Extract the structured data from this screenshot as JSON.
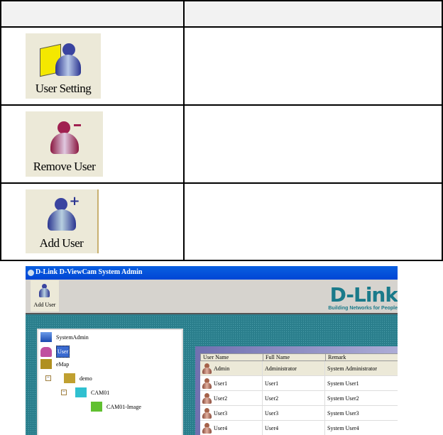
{
  "table": {
    "rows": [
      {
        "icon": "user-setting-icon",
        "label": "User Setting",
        "description": ""
      },
      {
        "icon": "remove-user-icon",
        "label": "Remove User",
        "description": ""
      },
      {
        "icon": "add-user-icon",
        "label": "Add User",
        "description": ""
      }
    ]
  },
  "window": {
    "title": "D-Link D-ViewCam System Admin",
    "toolbar": {
      "add_user": "Add User"
    },
    "logo": "D-Link",
    "slogan": "Building Networks for People",
    "tree": [
      {
        "label": "SystemAdmin",
        "icon": "system-admin-icon"
      },
      {
        "label": "User",
        "icon": "user-icon",
        "selected": true
      },
      {
        "label": "eMap",
        "icon": "emap-icon"
      },
      {
        "label": "demo",
        "icon": "map-icon"
      },
      {
        "label": "CAM01",
        "icon": "camera-icon"
      },
      {
        "label": "CAM01-Image",
        "icon": "camera-image-icon"
      }
    ],
    "grid": {
      "columns": [
        "User Name",
        "Full Name",
        "Remark"
      ],
      "rows": [
        [
          "Admin",
          "Administrator",
          "System Administrator"
        ],
        [
          "User1",
          "User1",
          "System User1"
        ],
        [
          "User2",
          "User2",
          "System User2"
        ],
        [
          "User3",
          "User3",
          "System User3"
        ],
        [
          "User4",
          "User4",
          "System User4"
        ]
      ]
    }
  }
}
